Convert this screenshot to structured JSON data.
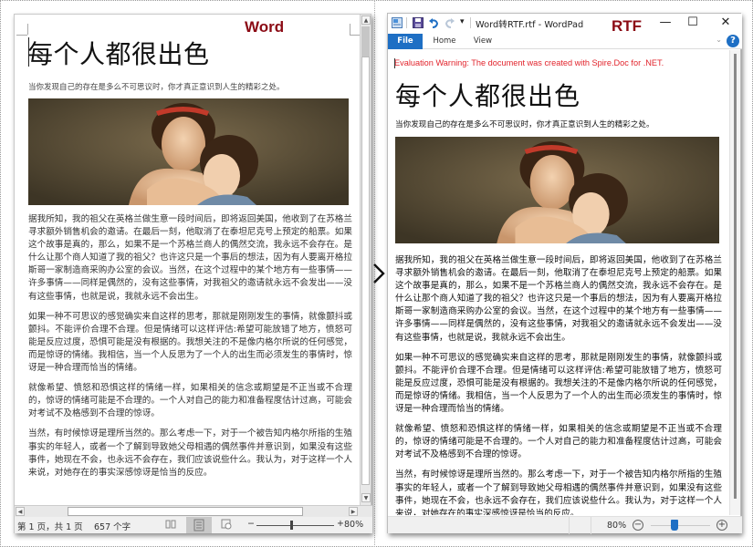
{
  "labels": {
    "word": "Word",
    "rtf": "RTF"
  },
  "document": {
    "title": "每个人都很出色",
    "subtitle": "当你发现自己的存在是多么不可思议时，你才真正意识到人生的精彩之处。",
    "image_alt": "painting-mother-and-daughter",
    "paragraphs_word": [
      "据我所知，我的祖父在英格兰做生意一段时间后，即将返回美国，他收到了在苏格兰寻求额外销售机会的邀请。在最后一刻，他取消了在泰坦尼克号上预定的船票。如果这个故事是真的，那么，如果不是一个苏格兰商人的偶然交流，我永远不会存在。是什么让那个商人知道了我的祖父？也许这只是一个事后的想法，因为有人要离开格拉斯哥一家制造商采购办公室的会议。当然，在这个过程中的某个地方有一些事情——许多事情——同样是偶然的，没有这些事情，对我祖父的邀请就永远不会发出——没有这些事情，也就是说，我就永远不会出生。",
      "如果一种不可思议的感觉确实来自这样的思考，那就是刚刚发生的事情，就像颤抖或颤抖。不能评价合理不合理。但是情绪可以这样评估:希望可能放错了地方，愤怒可能是反应过度，恐惧可能是没有根据的。我想关注的不是像内格尔所说的任何感觉，而是惊讶的情绪。我相信，当一个人反思为了一个人的出生而必须发生的事情时，惊讶是一种合理而恰当的情绪。",
      "就像希望、愤怒和恐惧这样的情绪一样，如果相关的信念或期望是不正当或不合理的，惊讶的情绪可能是不合理的。一个人对自己的能力和准备程度估计过高，可能会对考试不及格感到不合理的惊讶。",
      "当然，有时候惊讶是理所当然的。那么考虑一下，对于一个被告知内格尔所指的生殖事实的年轻人，或者一个了解到导致她父母相遇的偶然事件并意识到，如果没有这些事件，她现在不会，也永远不会存在，我们应该说些什么。我认为，对于这样一个人来说，对她存在的事实深感惊讶是恰当的反应。"
    ],
    "paragraphs_rtf": [
      "据我所知，我的祖父在英格兰做生意一段时间后，即将返回美国，他收到了在苏格兰寻求额外销售机会的邀请。在最后一刻，他取消了在泰坦尼克号上预定的船票。如果这个故事是真的，那么，如果不是一个苏格兰商人的偶然交流，我永远不会存在。是什么让那个商人知道了我的祖父？也许这只是一个事后的想法，因为有人要离开格拉斯哥一家制造商采购办公室的会议。当然，在这个过程中的某个地方有一些事情——许多事情——同样是偶然的，没有这些事情，对我祖父的邀请就永远不会发出——没有这些事情，也就是说，我就永远不会出生。",
      "如果一种不可思议的感觉确实来自这样的思考，那就是刚刚发生的事情，就像颤抖或颤抖。不能评价合理不合理。但是情绪可以这样评估:希望可能放错了地方，愤怒可能是反应过度，恐惧可能是没有根据的。我想关注的不是像内格尔所说的任何感觉，而是惊讶的情绪。我相信，当一个人反思为了一个人的出生而必须发生的事情时，惊讶是一种合理而恰当的情绪。",
      "就像希望、愤怒和恐惧这样的情绪一样，如果相关的信念或期望是不正当或不合理的，惊讶的情绪可能是不合理的。一个人对自己的能力和准备程度估计过高，可能会对考试不及格感到不合理的惊讶。",
      "当然，有时候惊讶是理所当然的。那么考虑一下，对于一个被告知内格尔所指的生殖事实的年轻人，或者一个了解到导致她父母相遇的偶然事件并意识到，如果没有这些事件，她现在不会，也永远不会存在，我们应该说些什么。我认为，对于这样一个人来说，对她存在的事实深感惊讶是恰当的反应。"
    ]
  },
  "word_window": {
    "status": {
      "page": "第 1 页，共 1 页",
      "word_count": "657 个字",
      "zoom_minus": "−",
      "zoom_plus": "+",
      "zoom_level": "80%",
      "zoom_fraction": 0.44
    },
    "scroll": {
      "up": "▲",
      "down": "▼",
      "left": "◀",
      "right": "▶"
    }
  },
  "wordpad_window": {
    "title": "Word转RTF.rtf - WordPad",
    "controls": {
      "minimize": "—",
      "maximize": "☐",
      "close": "✕"
    },
    "tabs": [
      {
        "label": "File"
      },
      {
        "label": "Home"
      },
      {
        "label": "View"
      }
    ],
    "help": "?",
    "collapse": "⌄",
    "warning": "Evaluation Warning: The document was created with Spire.Doc for .NET.",
    "status": {
      "zoom_level": "80%",
      "zoom_out": "−",
      "zoom_in": "+",
      "zoom_fraction": 0.4
    }
  },
  "colors": {
    "label_red": "#8b0a14",
    "accent_blue": "#1e6fc4",
    "warning_red": "#e2242c"
  }
}
